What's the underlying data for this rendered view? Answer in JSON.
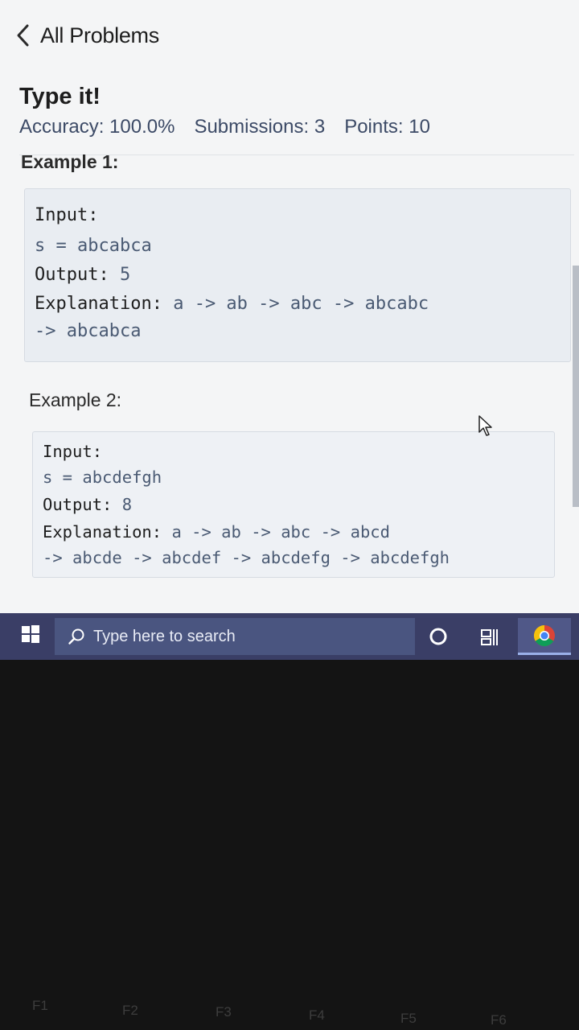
{
  "nav": {
    "back_label": "All Problems"
  },
  "problem": {
    "title": "Type it!",
    "accuracy": "Accuracy: 100.0%",
    "submissions": "Submissions: 3",
    "points": "Points: 10"
  },
  "examples": [
    {
      "heading": "Example 1:",
      "input_label": "Input:",
      "input_value": "s = abcabca",
      "output_label": "Output:",
      "output_value": "5",
      "explanation_label": "Explanation:",
      "explanation_line1": "a -> ab -> abc -> abcabc",
      "explanation_line2": "-> abcabca"
    },
    {
      "heading": "Example 2:",
      "input_label": "Input:",
      "input_value": "s = abcdefgh",
      "output_label": "Output:",
      "output_value": "8",
      "explanation_label": "Explanation:",
      "explanation_line1": "a -> ab -> abc -> abcd",
      "explanation_line2": "-> abcde -> abcdef -> abcdefg -> abcdefgh"
    }
  ],
  "taskbar": {
    "search_placeholder": "Type here to search",
    "icons": [
      "windows-start-icon",
      "search-icon",
      "cortana-icon",
      "task-view-icon",
      "chrome-icon"
    ]
  },
  "keyboard": {
    "keys": [
      "F1",
      "F2",
      "F3",
      "F4",
      "F5",
      "F6"
    ]
  }
}
